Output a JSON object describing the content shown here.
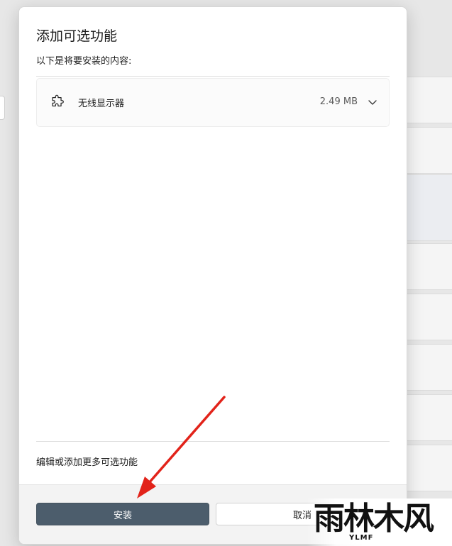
{
  "dialog": {
    "title": "添加可选功能",
    "subtitle": "以下是将要安装的内容:",
    "feature": {
      "icon": "puzzle-piece-icon",
      "name": "无线显示器",
      "size": "2.49 MB"
    },
    "edit_link": "编辑或添加更多可选功能",
    "install_label": "安装",
    "cancel_label": "取消"
  },
  "watermark": {
    "main": "雨林木风",
    "sub": "YLMF"
  },
  "colors": {
    "install_button": "#4c5d6c",
    "arrow": "#e2231a"
  }
}
